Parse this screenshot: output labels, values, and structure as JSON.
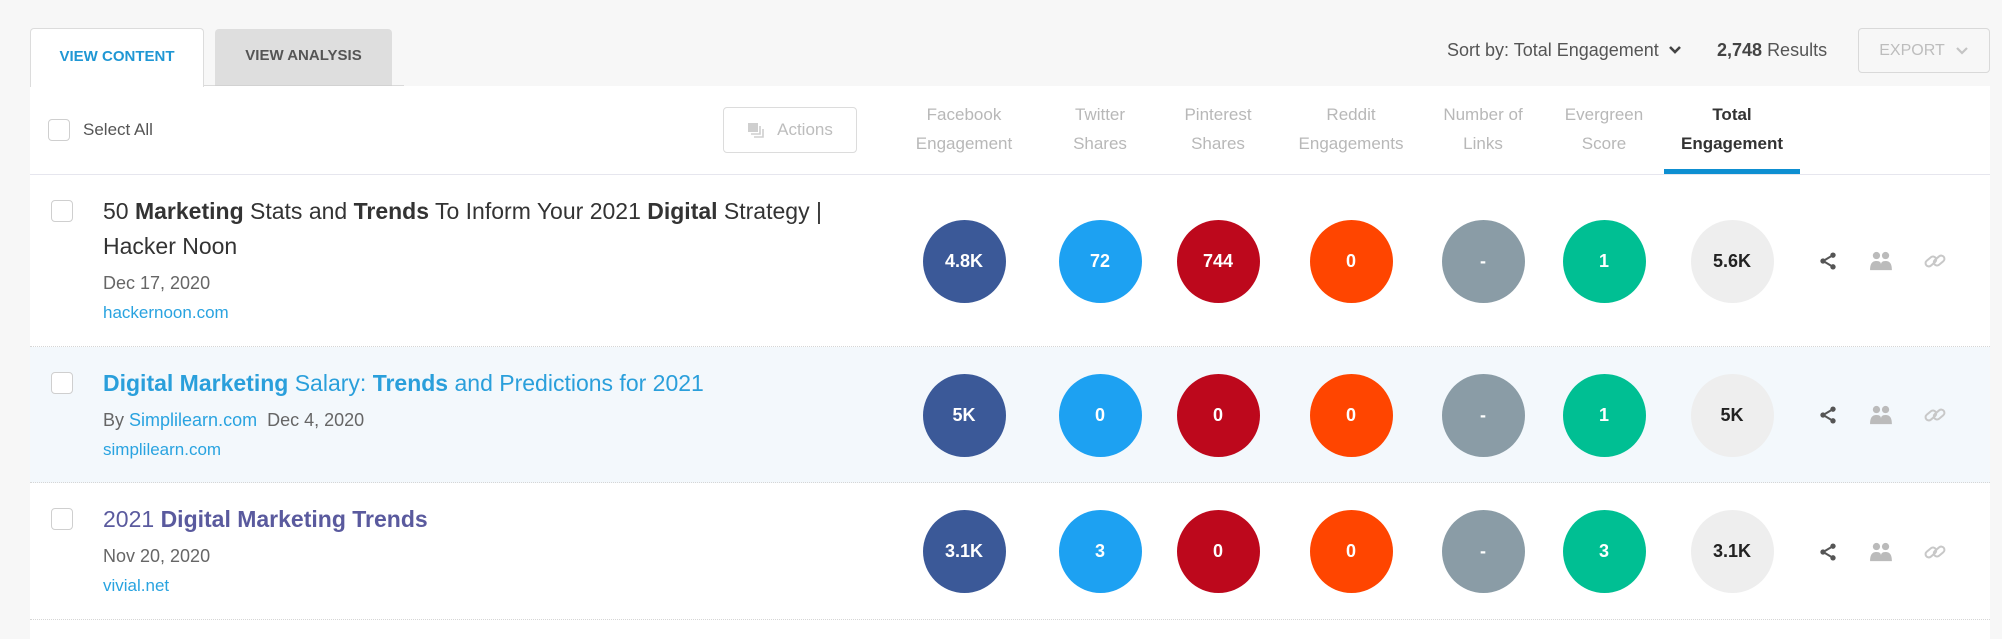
{
  "tabs": [
    {
      "label": "VIEW CONTENT",
      "active": true
    },
    {
      "label": "VIEW ANALYSIS",
      "active": false
    }
  ],
  "toolbar": {
    "sort_label": "Sort by: Total Engagement",
    "results_count": "2,748",
    "results_label": "Results",
    "export_label": "EXPORT"
  },
  "table": {
    "select_all_label": "Select All",
    "actions_label": "Actions",
    "columns": [
      {
        "key": "facebook-engagement",
        "line1": "Facebook",
        "line2": "Engagement",
        "active": false,
        "color": "#3b5998",
        "text_color": "#ffffff"
      },
      {
        "key": "twitter-shares",
        "line1": "Twitter",
        "line2": "Shares",
        "active": false,
        "color": "#1da1f2",
        "text_color": "#ffffff"
      },
      {
        "key": "pinterest-shares",
        "line1": "Pinterest",
        "line2": "Shares",
        "active": false,
        "color": "#bd081c",
        "text_color": "#ffffff"
      },
      {
        "key": "reddit-engagements",
        "line1": "Reddit",
        "line2": "Engagements",
        "active": false,
        "color": "#ff4500",
        "text_color": "#ffffff"
      },
      {
        "key": "number-of-links",
        "line1": "Number of",
        "line2": "Links",
        "active": false,
        "color": "#8a9ca6",
        "text_color": "#ffffff"
      },
      {
        "key": "evergreen-score",
        "line1": "Evergreen",
        "line2": "Score",
        "active": false,
        "color": "#00bf93",
        "text_color": "#ffffff"
      },
      {
        "key": "total-engagement",
        "line1": "Total",
        "line2": "Engagement",
        "active": true,
        "color": "#eeeeee",
        "text_color": "#222222"
      }
    ],
    "row_actions": [
      {
        "icon": "share-icon",
        "color": "#555555"
      },
      {
        "icon": "people-icon",
        "color": "#bbbbbb"
      },
      {
        "icon": "link-icon",
        "color": "#c8c8c8"
      }
    ]
  },
  "rows": [
    {
      "title_segments": [
        {
          "text": "50 ",
          "bold": false
        },
        {
          "text": "Marketing",
          "bold": true
        },
        {
          "text": " Stats and ",
          "bold": false
        },
        {
          "text": "Trends",
          "bold": true
        },
        {
          "text": " To Inform Your 2021 ",
          "bold": false
        },
        {
          "text": "Digital",
          "bold": true
        },
        {
          "text": " Strategy | Hacker Noon",
          "bold": false
        }
      ],
      "title_color": "#333333",
      "byline_prefix": null,
      "author": null,
      "date": "Dec 17, 2020",
      "domain": "hackernoon.com",
      "highlighted": false,
      "metrics": [
        "4.8K",
        "72",
        "744",
        "0",
        "-",
        "1",
        "5.6K"
      ]
    },
    {
      "title_segments": [
        {
          "text": "Digital Marketing",
          "bold": true
        },
        {
          "text": " Salary: ",
          "bold": false
        },
        {
          "text": "Trends",
          "bold": true
        },
        {
          "text": " and Predictions for 2021",
          "bold": false
        }
      ],
      "title_color": "#2a9fdb",
      "byline_prefix": "By",
      "author": "Simplilearn.com",
      "date": "Dec 4, 2020",
      "domain": "simplilearn.com",
      "highlighted": true,
      "metrics": [
        "5K",
        "0",
        "0",
        "0",
        "-",
        "1",
        "5K"
      ]
    },
    {
      "title_segments": [
        {
          "text": "2021 ",
          "bold": false
        },
        {
          "text": "Digital Marketing Trends",
          "bold": true
        }
      ],
      "title_color": "#5a5a9e",
      "byline_prefix": null,
      "author": null,
      "date": "Nov 20, 2020",
      "domain": "vivial.net",
      "highlighted": false,
      "metrics": [
        "3.1K",
        "3",
        "0",
        "0",
        "-",
        "3",
        "3.1K"
      ]
    }
  ]
}
